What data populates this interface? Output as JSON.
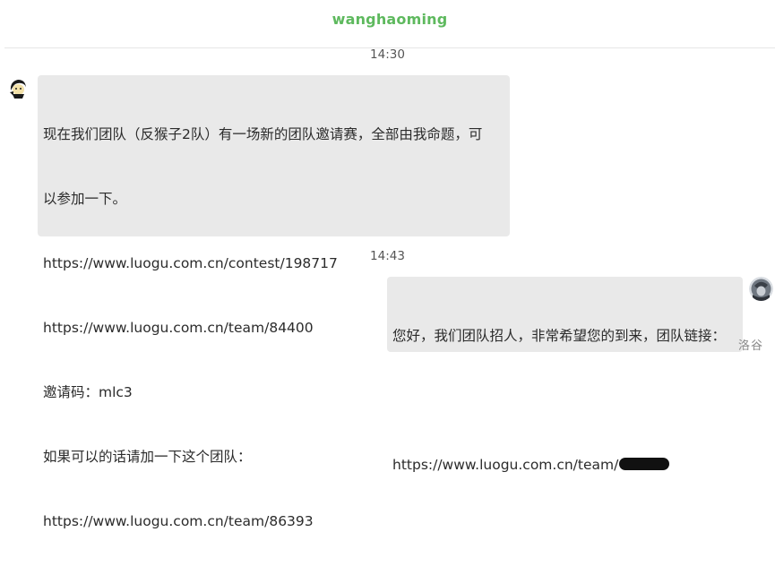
{
  "header": {
    "title": "wanghaoming"
  },
  "timestamps": [
    "14:30",
    "14:43"
  ],
  "messages": [
    {
      "side": "left",
      "lines": [
        "现在我们团队（反猴子2队）有一场新的团队邀请赛，全部由我命题，可",
        "以参加一下。",
        "https://www.luogu.com.cn/contest/198717",
        "https://www.luogu.com.cn/team/84400",
        "邀请码：mlc3",
        "如果可以的话请加一下这个团队：",
        "https://www.luogu.com.cn/team/86393"
      ]
    },
    {
      "side": "right",
      "lines": [
        "您好，我们团队招人，非常希望您的到来，团队链接：",
        "",
        "https://www.luogu.com.cn/team/"
      ]
    }
  ],
  "watermark": "洛谷",
  "colors": {
    "title": "#5eb95e",
    "bubble": "#e9e9e9",
    "text": "#2b2b2b"
  }
}
